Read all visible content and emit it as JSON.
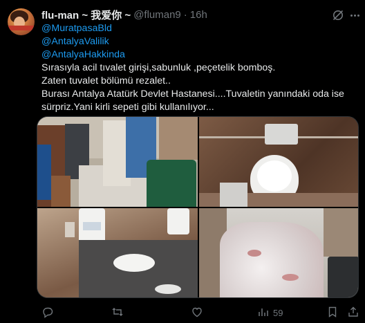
{
  "author": {
    "name": "flu-man ~ 我爱你 ~",
    "handle": "@fluman9",
    "separator": "·",
    "time": "16h"
  },
  "tweet": {
    "mentions": [
      "@MuratpasaBld",
      "@AntalyaValilik",
      "@AntalyaHakkinda"
    ],
    "lines": [
      "Sırasıyla acil tıvalet girişi,sabunluk ,peçetelik bomboş.",
      "Zaten tuvalet bölümü rezalet..",
      "Burası Antalya Atatürk Devlet Hastanesi....Tuvaletin yanındaki oda ise",
      "sürpriz.Yani kirli sepeti gibi kullanılıyor..."
    ]
  },
  "media": {
    "photos": [
      {
        "name": "photo-toilet-entrance"
      },
      {
        "name": "photo-toilet-bowl"
      },
      {
        "name": "photo-sink-dispensers"
      },
      {
        "name": "photo-dirty-laundry-room"
      }
    ]
  },
  "actions": {
    "reply": {
      "icon": "reply-icon",
      "count": ""
    },
    "retweet": {
      "icon": "retweet-icon",
      "count": ""
    },
    "like": {
      "icon": "heart-icon",
      "count": ""
    },
    "views": {
      "icon": "views-icon",
      "count": "59"
    },
    "bookmark": {
      "icon": "bookmark-icon"
    },
    "share": {
      "icon": "share-icon"
    }
  },
  "colors": {
    "background": "#000000",
    "text": "#e7e9ea",
    "muted": "#71767b",
    "link": "#1d9bf0",
    "border": "#2f3336"
  }
}
